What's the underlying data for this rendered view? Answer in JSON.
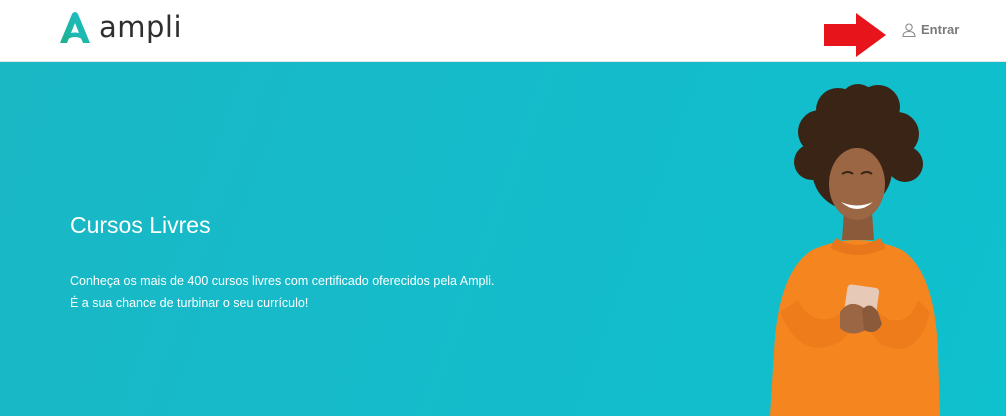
{
  "header": {
    "brand": "ampli",
    "login_label": "Entrar"
  },
  "hero": {
    "title": "Cursos Livres",
    "description_line1": "Conheça os mais de 400 cursos livres com certificado oferecidos pela Ampli.",
    "description_line2": "É a sua chance de turbinar o seu currículo!"
  },
  "colors": {
    "brand_teal": "#14bccb",
    "annotation_arrow": "#e8141b",
    "sweater": "#f5861f"
  }
}
